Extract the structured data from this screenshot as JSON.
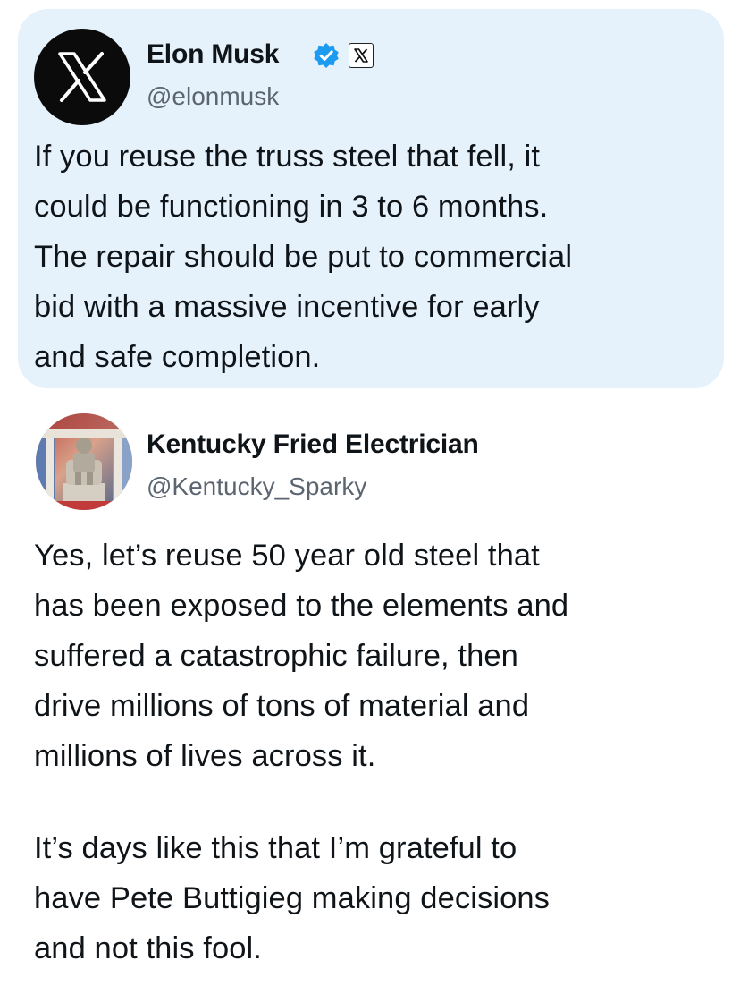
{
  "quoted_tweet": {
    "author_name": "Elon Musk",
    "author_handle": "@elonmusk",
    "avatar_icon": "x-logo-icon",
    "verified_icon": "verified-badge-icon",
    "affiliation_icon": "x-affiliate-badge-icon",
    "text": "If you reuse the truss steel that fell, it\ncould be functioning in 3 to 6 months.\nThe repair should be put to commercial\nbid with a massive incentive for early\nand safe completion.",
    "card_background": "#e5f1fb",
    "verified_color": "#1d9bf0"
  },
  "reply_tweet": {
    "author_name": "Kentucky Fried Electrician",
    "author_handle": "@Kentucky_Sparky",
    "avatar_icon": "lincoln-memorial-avatar",
    "paragraph_1": "Yes, let’s reuse 50 year old steel that\nhas been exposed to the elements and\nsuffered a catastrophic failure, then\ndrive millions of tons of material and\nmillions of lives across it.",
    "paragraph_2": "It’s days like this that I’m grateful to\nhave Pete Buttigieg making decisions\nand not this fool."
  }
}
